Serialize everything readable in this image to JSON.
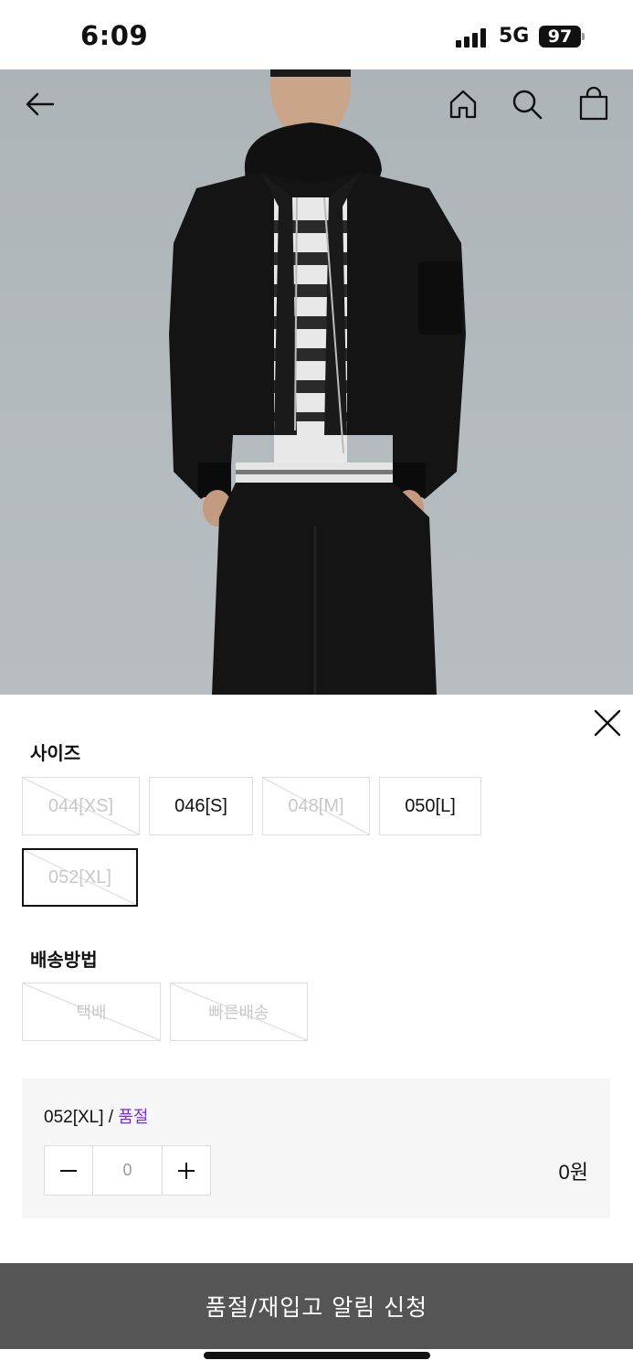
{
  "status_bar": {
    "time": "6:09",
    "network": "5G",
    "battery": "97"
  },
  "hero": {
    "icons": [
      "arrow-left-icon",
      "home-icon",
      "search-icon",
      "shopping-bag-icon"
    ],
    "photo": "model wearing black bomber jacket with hood and striped knit, black trousers"
  },
  "sheet": {
    "size_title": "사이즈",
    "sizes": [
      {
        "label": "044[XS]",
        "state": "soldout"
      },
      {
        "label": "046[S]",
        "state": "available"
      },
      {
        "label": "048[M]",
        "state": "soldout"
      },
      {
        "label": "050[L]",
        "state": "available"
      },
      {
        "label": "052[XL]",
        "state": "selected-soldout"
      }
    ],
    "delivery_title": "배송방법",
    "delivery": [
      {
        "label": "택배",
        "state": "soldout"
      },
      {
        "label": "빠른배송",
        "state": "soldout"
      }
    ],
    "summary": {
      "option": "052[XL]",
      "separator": " / ",
      "status": "품절",
      "quantity": "0",
      "price": "0원"
    },
    "cta_label": "품절/재입고 알림 신청"
  },
  "colors": {
    "accent_purple": "#7a2bd6",
    "cta_bg": "#555555",
    "border": "#dddddd",
    "soldout_text": "#c8c8c8"
  }
}
